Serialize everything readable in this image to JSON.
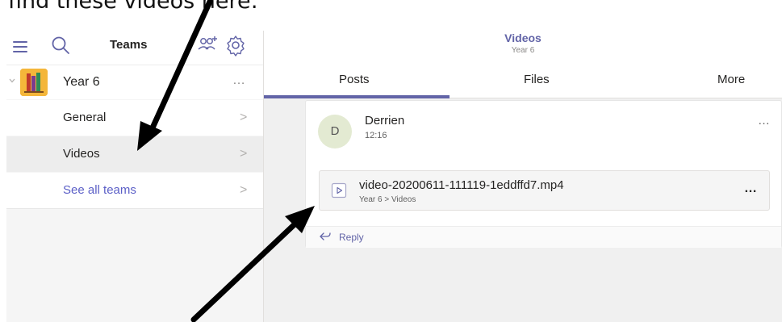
{
  "caption": "find these videos here:",
  "sidebar": {
    "title": "Teams",
    "team": {
      "name": "Year 6",
      "more": "…",
      "avatar_color": "#f4a72f"
    },
    "channels": [
      {
        "label": "General",
        "chevron": ">"
      },
      {
        "label": "Videos",
        "chevron": ">",
        "selected": true
      },
      {
        "label": "See all teams",
        "chevron": ">"
      }
    ]
  },
  "channel_header": {
    "title": "Videos",
    "subtitle": "Year 6"
  },
  "tabs": [
    {
      "label": "Posts",
      "active": true
    },
    {
      "label": "Files"
    },
    {
      "label": "More"
    }
  ],
  "post": {
    "avatar_initial": "D",
    "author": "Derrien",
    "time": "12:16",
    "more": "…",
    "attachment": {
      "file_name": "video-20200611-111119-1eddffd7.mp4",
      "path": "Year 6 > Videos",
      "more": "…"
    },
    "reply_label": "Reply"
  },
  "colors": {
    "accent": "#6264a7",
    "link": "#5b5fc7",
    "selected_row": "#ededed",
    "annotation_arrow": "#000000"
  },
  "icons": [
    "hamburger-icon",
    "search-icon",
    "team-people-icon",
    "gear-icon",
    "chevron-down-icon",
    "chevron-right-icon",
    "video-file-icon",
    "reply-icon",
    "more-icon"
  ]
}
